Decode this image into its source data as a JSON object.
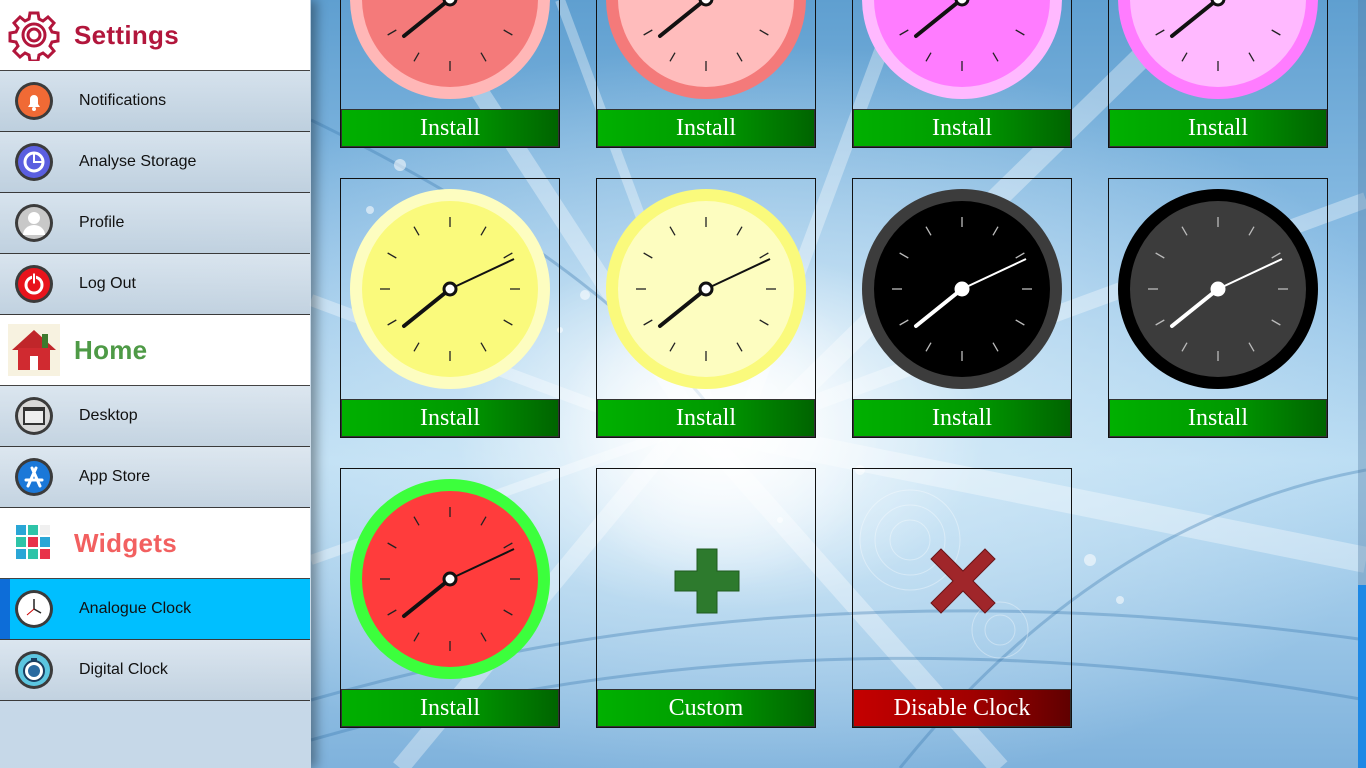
{
  "sidebar": {
    "settings": {
      "title": "Settings",
      "color": "#b2163c",
      "icon": "gear-icon",
      "items": [
        {
          "label": "Notifications",
          "icon": "bell-icon"
        },
        {
          "label": "Analyse Storage",
          "icon": "storage-icon"
        },
        {
          "label": "Profile",
          "icon": "user-icon"
        },
        {
          "label": "Log Out",
          "icon": "power-icon"
        }
      ]
    },
    "home": {
      "title": "Home",
      "color": "#4e9a46",
      "icon": "house-icon",
      "items": [
        {
          "label": "Desktop",
          "icon": "desktop-icon"
        },
        {
          "label": "App Store",
          "icon": "app-store-icon"
        }
      ]
    },
    "widgets": {
      "title": "Widgets",
      "color": "#f26060",
      "icon": "widgets-grid-icon",
      "items": [
        {
          "label": "Analogue Clock",
          "icon": "analogue-clock-icon",
          "active": true
        },
        {
          "label": "Digital Clock",
          "icon": "digital-clock-icon"
        }
      ]
    }
  },
  "gallery": {
    "clocks": [
      {
        "button": "Install",
        "face": "#f47a7a",
        "rim": "#ffb7b7",
        "ticks": "#222222",
        "hands": "#111111"
      },
      {
        "button": "Install",
        "face": "#ffbcbc",
        "rim": "#f47a7a",
        "ticks": "#222222",
        "hands": "#111111"
      },
      {
        "button": "Install",
        "face": "#ff7cff",
        "rim": "#ffb9ff",
        "ticks": "#222222",
        "hands": "#111111"
      },
      {
        "button": "Install",
        "face": "#ffb9ff",
        "rim": "#ff7cff",
        "ticks": "#222222",
        "hands": "#111111"
      },
      {
        "button": "Install",
        "face": "#fafa7c",
        "rim": "#fdfdc0",
        "ticks": "#222222",
        "hands": "#111111"
      },
      {
        "button": "Install",
        "face": "#fdfdc0",
        "rim": "#fafa7c",
        "ticks": "#222222",
        "hands": "#111111"
      },
      {
        "button": "Install",
        "face": "#000000",
        "rim": "#3c3c3c",
        "ticks": "#bbbbbb",
        "hands": "#ffffff"
      },
      {
        "button": "Install",
        "face": "#3c3c3c",
        "rim": "#000000",
        "ticks": "#bbbbbb",
        "hands": "#ffffff"
      },
      {
        "button": "Install",
        "face": "#ff3c3c",
        "rim": "#3cff3c",
        "ticks": "#222222",
        "hands": "#111111"
      }
    ],
    "custom": {
      "button": "Custom",
      "icon": "plus-icon",
      "color": "#2d7a2d"
    },
    "disable": {
      "button": "Disable Clock",
      "icon": "x-icon",
      "color": "#a0262a"
    }
  }
}
